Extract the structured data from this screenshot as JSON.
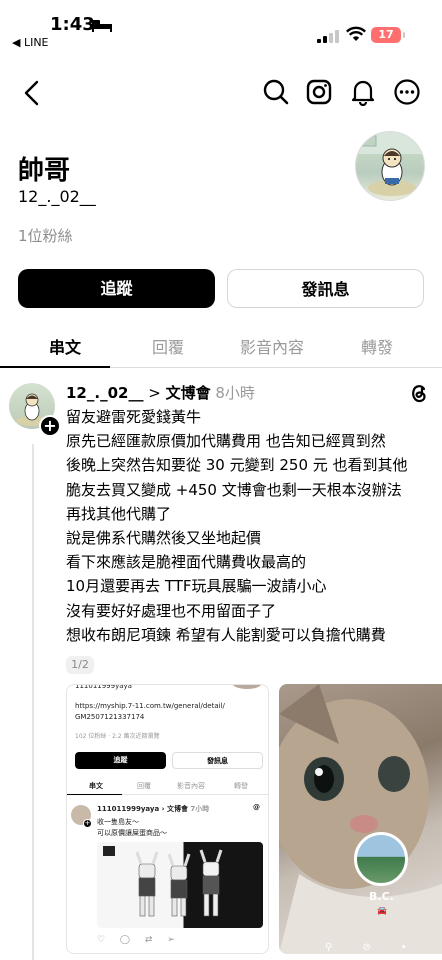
{
  "status": {
    "time": "1:43",
    "back_app": "◀ LINE",
    "battery": "17"
  },
  "profile": {
    "name": "帥哥",
    "handle": "12_._02__",
    "followers": "1位粉絲",
    "follow_label": "追蹤",
    "message_label": "發訊息"
  },
  "tabs": [
    "串文",
    "回覆",
    "影音內容",
    "轉發"
  ],
  "post": {
    "username": "12_._02__",
    "separator": ">",
    "topic": "文博會",
    "time": "8小時",
    "lines": [
      "留友避雷死愛錢黃牛",
      "原先已經匯款原價加代購費用 也告知已經買到然",
      "後晚上突然告知要從 30 元變到 250 元 也看到其他",
      "脆友去買又變成 +450 文博會也剩一天根本沒辦法",
      "再找其他代購了",
      "說是佛系代購然後又坐地起價",
      "看下來應該是脆裡面代購費收最高的",
      "10月還要再去 TTF玩具展騙一波請小心",
      "沒有要好好處理也不用留面子了",
      "想收布朗尼項鍊 希望有人能割愛可以負擔代購費"
    ],
    "page_indicator": "1/2"
  },
  "shot1": {
    "username": "111011999yaya",
    "link1": "https://myship.7-11.com.tw/general/detail/",
    "link2": "GM2507121337174",
    "stats": "102 位粉絲 · 2.2 萬次近期瀏覽",
    "follow": "追蹤",
    "message": "發訊息",
    "tabs": [
      "串文",
      "回覆",
      "影音內容",
      "轉發"
    ],
    "post_user": "111011999yaya",
    "post_topic": "文博會",
    "post_time": "7小時",
    "post_line1": "收一隻島友～",
    "post_line2": "可以原價讓屎蛋商品～"
  },
  "shot2": {
    "caption": "B.C."
  }
}
